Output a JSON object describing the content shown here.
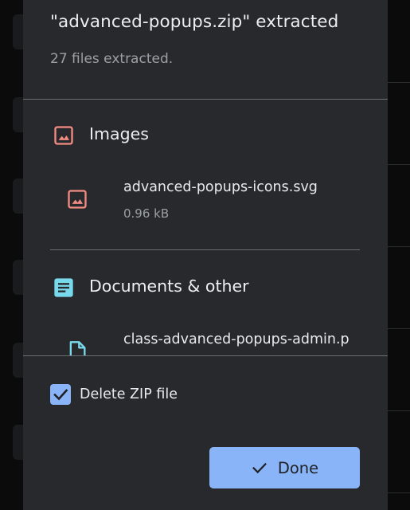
{
  "dialog": {
    "title": "\"advanced-popups.zip\" extracted",
    "subtitle": "27 files extracted."
  },
  "sections": [
    {
      "title": "Images",
      "icon": "image-icon",
      "icon_color": "#f28b82",
      "files": [
        {
          "name": "advanced-popups-icons.svg",
          "size": "0.96 kB",
          "icon": "image-file-icon"
        }
      ]
    },
    {
      "title": "Documents & other",
      "icon": "document-icon",
      "icon_color": "#78d9ec",
      "files": [
        {
          "name": "class-advanced-popups-admin.p",
          "icon": "file-icon"
        }
      ]
    }
  ],
  "delete_zip": {
    "label": "Delete ZIP file",
    "checked": true
  },
  "done_button": {
    "label": "Done",
    "icon": "check-icon"
  },
  "colors": {
    "dialog_bg": "#28292c",
    "accent": "#8ab4f8",
    "image_icon": "#f28b82",
    "document_icon": "#78d9ec"
  }
}
